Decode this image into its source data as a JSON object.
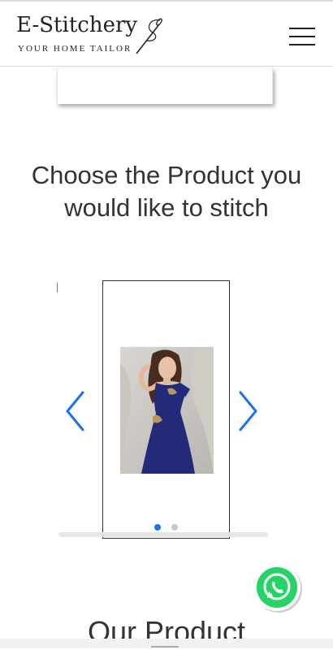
{
  "header": {
    "brand_name": "E-Stitchery",
    "tagline": "YOUR HOME TAILOR",
    "logo_icon": "needle-thread-icon",
    "menu_icon": "hamburger-menu-icon"
  },
  "main": {
    "section_title_line1": "Choose the Product you",
    "section_title_line2": "would like to stitch",
    "stray_mark": "]",
    "carousel": {
      "prev_icon": "chevron-left-icon",
      "next_icon": "chevron-right-icon",
      "arrow_color": "#1a73e8",
      "slides": [
        {
          "image": "blue-gown-product-photo"
        }
      ],
      "active_dot_color": "#1a73e8",
      "inactive_dot_color": "#c8c8c8",
      "dot_count": 2,
      "active_index": 0
    },
    "next_section_title": "Our Product"
  },
  "whatsapp": {
    "icon": "whatsapp-icon",
    "color": "#25d366"
  }
}
